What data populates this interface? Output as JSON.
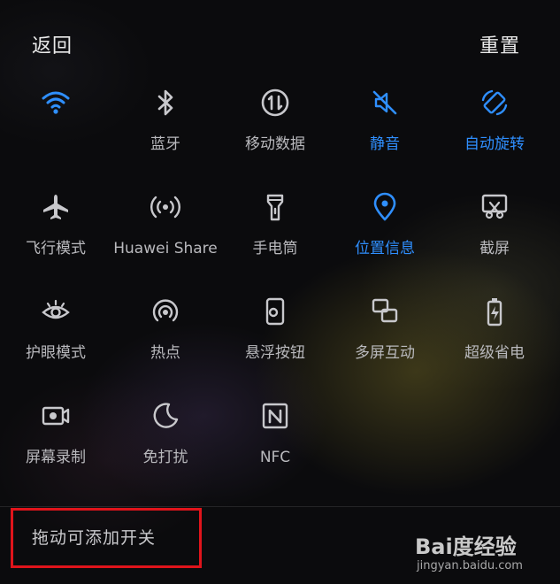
{
  "header": {
    "back_label": "返回",
    "reset_label": "重置"
  },
  "colors": {
    "active": "#2f8fff",
    "inactive": "#c8c8cc",
    "highlight_box": "#e0141b"
  },
  "tiles": [
    {
      "label": "",
      "icon": "wifi-icon",
      "active": true
    },
    {
      "label": "蓝牙",
      "icon": "bluetooth-icon",
      "active": false
    },
    {
      "label": "移动数据",
      "icon": "mobile-data-icon",
      "active": false
    },
    {
      "label": "静音",
      "icon": "mute-icon",
      "active": true
    },
    {
      "label": "自动旋转",
      "icon": "auto-rotate-icon",
      "active": true
    },
    {
      "label": "飞行模式",
      "icon": "airplane-icon",
      "active": false
    },
    {
      "label": "Huawei Share",
      "icon": "huawei-share-icon",
      "active": false
    },
    {
      "label": "手电筒",
      "icon": "flashlight-icon",
      "active": false
    },
    {
      "label": "位置信息",
      "icon": "location-icon",
      "active": true
    },
    {
      "label": "截屏",
      "icon": "screenshot-icon",
      "active": false
    },
    {
      "label": "护眼模式",
      "icon": "eye-comfort-icon",
      "active": false
    },
    {
      "label": "热点",
      "icon": "hotspot-icon",
      "active": false
    },
    {
      "label": "悬浮按钮",
      "icon": "floating-button-icon",
      "active": false
    },
    {
      "label": "多屏互动",
      "icon": "multi-screen-icon",
      "active": false
    },
    {
      "label": "超级省电",
      "icon": "ultra-power-saving-icon",
      "active": false
    },
    {
      "label": "屏幕录制",
      "icon": "screen-record-icon",
      "active": false
    },
    {
      "label": "免打扰",
      "icon": "do-not-disturb-icon",
      "active": false
    },
    {
      "label": "NFC",
      "icon": "nfc-icon",
      "active": false
    }
  ],
  "footer": {
    "hint": "拖动可添加开关"
  },
  "watermark": {
    "logo_text": "Bai度经验",
    "url": "jingyan.baidu.com"
  }
}
